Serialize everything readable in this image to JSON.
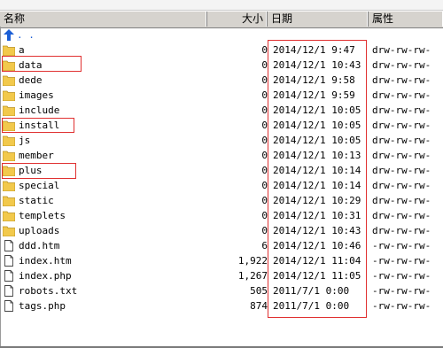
{
  "path_hint": "",
  "columns": {
    "name": "名称",
    "size": "大小",
    "date": "日期",
    "perms": "属性"
  },
  "parent": {
    "label": ". ."
  },
  "files": [
    {
      "name": "a",
      "size": "0",
      "date": "2014/12/1  9:47",
      "perms": "drw-rw-rw-",
      "type": "folder"
    },
    {
      "name": "data",
      "size": "0",
      "date": "2014/12/1  10:43",
      "perms": "drw-rw-rw-",
      "type": "folder"
    },
    {
      "name": "dede",
      "size": "0",
      "date": "2014/12/1  9:58",
      "perms": "drw-rw-rw-",
      "type": "folder"
    },
    {
      "name": "images",
      "size": "0",
      "date": "2014/12/1  9:59",
      "perms": "drw-rw-rw-",
      "type": "folder"
    },
    {
      "name": "include",
      "size": "0",
      "date": "2014/12/1  10:05",
      "perms": "drw-rw-rw-",
      "type": "folder"
    },
    {
      "name": "install",
      "size": "0",
      "date": "2014/12/1  10:05",
      "perms": "drw-rw-rw-",
      "type": "folder"
    },
    {
      "name": "js",
      "size": "0",
      "date": "2014/12/1  10:05",
      "perms": "drw-rw-rw-",
      "type": "folder"
    },
    {
      "name": "member",
      "size": "0",
      "date": "2014/12/1  10:13",
      "perms": "drw-rw-rw-",
      "type": "folder"
    },
    {
      "name": "plus",
      "size": "0",
      "date": "2014/12/1  10:14",
      "perms": "drw-rw-rw-",
      "type": "folder"
    },
    {
      "name": "special",
      "size": "0",
      "date": "2014/12/1  10:14",
      "perms": "drw-rw-rw-",
      "type": "folder"
    },
    {
      "name": "static",
      "size": "0",
      "date": "2014/12/1  10:29",
      "perms": "drw-rw-rw-",
      "type": "folder"
    },
    {
      "name": "templets",
      "size": "0",
      "date": "2014/12/1  10:31",
      "perms": "drw-rw-rw-",
      "type": "folder"
    },
    {
      "name": "uploads",
      "size": "0",
      "date": "2014/12/1  10:43",
      "perms": "drw-rw-rw-",
      "type": "folder"
    },
    {
      "name": "ddd.htm",
      "size": "6",
      "date": "2014/12/1  10:46",
      "perms": "-rw-rw-rw-",
      "type": "file"
    },
    {
      "name": "index.htm",
      "size": "1,922",
      "date": "2014/12/1  11:04",
      "perms": "-rw-rw-rw-",
      "type": "file"
    },
    {
      "name": "index.php",
      "size": "1,267",
      "date": "2014/12/1  11:05",
      "perms": "-rw-rw-rw-",
      "type": "file"
    },
    {
      "name": "robots.txt",
      "size": "505",
      "date": "2011/7/1  0:00",
      "perms": "-rw-rw-rw-",
      "type": "file"
    },
    {
      "name": "tags.php",
      "size": "874",
      "date": "2011/7/1  0:00",
      "perms": "-rw-rw-rw-",
      "type": "file"
    }
  ],
  "colors": {
    "highlight": "#e03030",
    "header": "#d6d3ce",
    "folder": "#f2c94c",
    "parent_arrow": "#1c5fd6"
  }
}
